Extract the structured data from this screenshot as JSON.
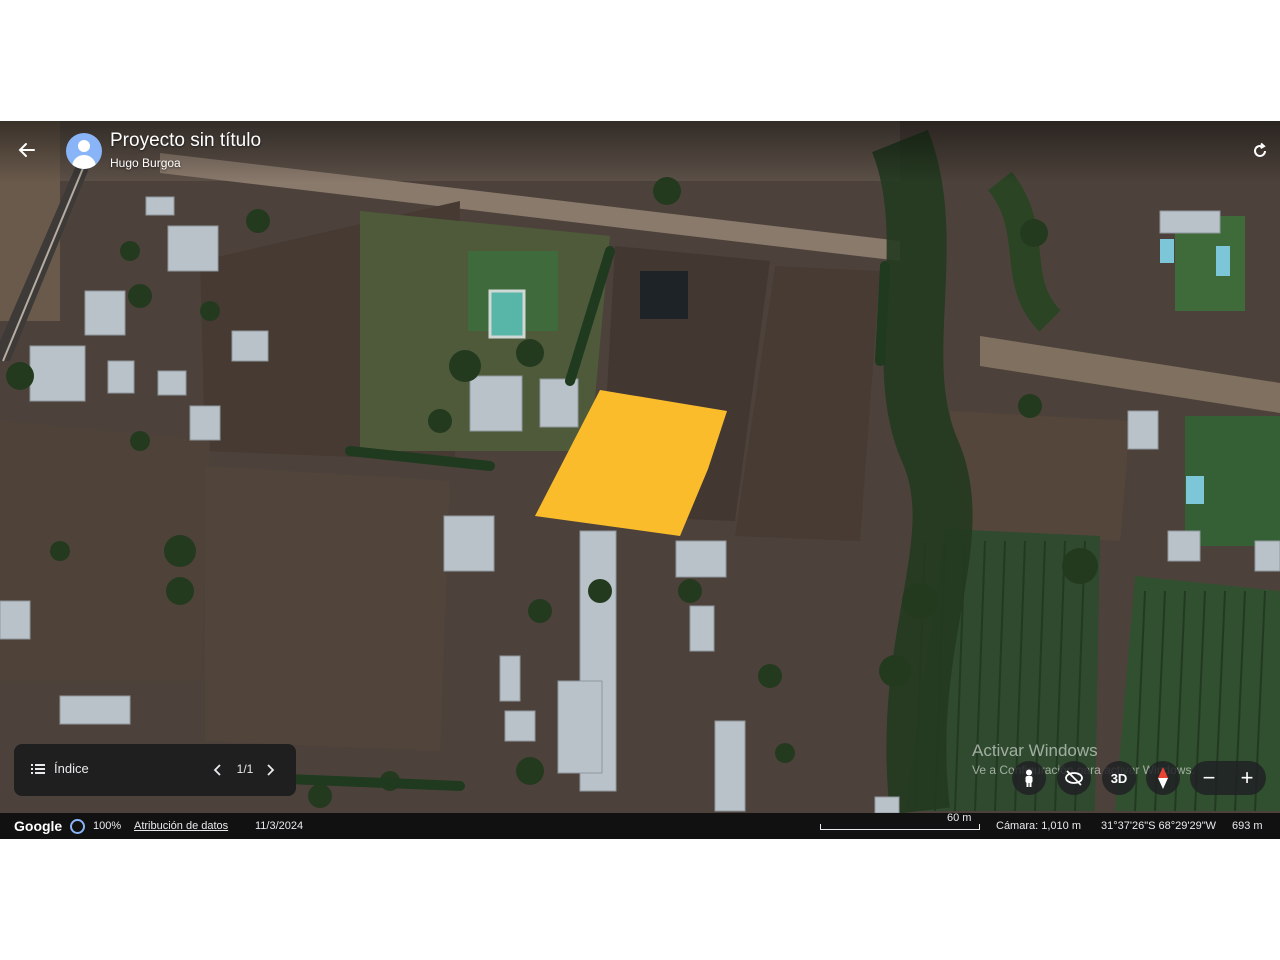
{
  "project": {
    "title": "Proyecto sin título",
    "owner": "Hugo Burgoa"
  },
  "index_panel": {
    "label": "Índice",
    "page": "1/1"
  },
  "map_controls": {
    "mode_3d": "3D",
    "zoom_out": "−",
    "zoom_in": "+"
  },
  "watermark": {
    "title": "Activar Windows",
    "subtitle": "Ve a Configuración para activar Windows."
  },
  "status_bar": {
    "logo": "Google",
    "quality": "100%",
    "attribution": "Atribución de datos",
    "date": "11/3/2024",
    "scale": "60 m",
    "camera": "Cámara: 1,010 m",
    "coordinates": "31°37'26\"S 68°29'29\"W",
    "elevation": "693 m"
  },
  "colors": {
    "polygon_fill": "#fbbc2c",
    "status_bg": "#111111",
    "panel_bg": "#1f1f1f",
    "avatar": "#8ab4f8"
  },
  "icons": [
    "back-arrow-icon",
    "avatar-icon",
    "refresh-icon",
    "list-icon",
    "chevron-left-icon",
    "chevron-right-icon",
    "pegman-icon",
    "tilt-icon",
    "compass-icon"
  ]
}
